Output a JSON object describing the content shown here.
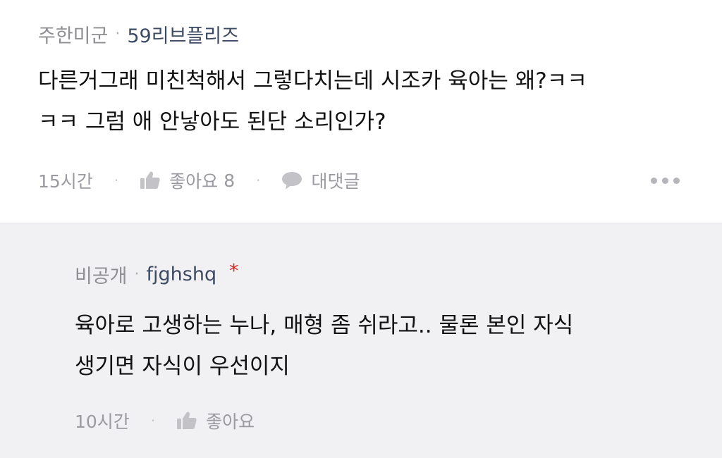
{
  "comments": [
    {
      "region": "주한미군",
      "separator": "·",
      "nickname": "59리브플리즈",
      "body_lines": [
        "다른거그래 미친척해서 그렇다치는데 시조카 육아는 왜?ㅋㅋ",
        "ㅋㅋ 그럼 애 안낳아도 된단 소리인가?"
      ],
      "time": "15시간",
      "like_label": "좋아요",
      "like_count": "8",
      "reply_label": "대댓글",
      "action_separator": "·"
    },
    {
      "region": "비공개",
      "separator": "·",
      "nickname": "fjghshq",
      "author_mark": "*",
      "body_lines": [
        "육아로 고생하는 누나, 매형 좀 쉬라고.. 물론 본인 자식",
        "생기면 자식이 우선이지"
      ],
      "time": "10시간",
      "like_label": "좋아요",
      "action_separator": "·"
    }
  ],
  "icons": {
    "like": "thumbs-up-icon",
    "reply": "speech-bubble-icon",
    "more": "more-dots-icon"
  },
  "colors": {
    "reply_background": "#f1f1f3",
    "nickname": "#3d4a63",
    "meta_gray": "#9a9aa0",
    "author_mark": "#e02020"
  }
}
